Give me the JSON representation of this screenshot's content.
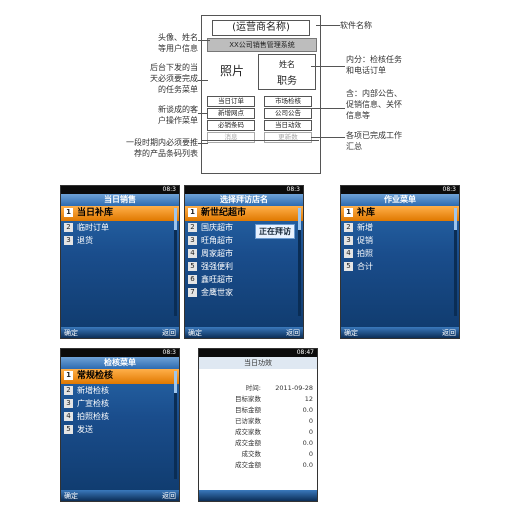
{
  "wireframe": {
    "title": "(运营商名称)",
    "subtitle": "XX公司销售管理系统",
    "photo": "照片",
    "name": "姓名",
    "position": "职务",
    "buttons": [
      "当日订单",
      "市场检核",
      "新增网点",
      "公司公告",
      "必销条码",
      "当日动效",
      "消息",
      "更新数"
    ],
    "annotations_left": [
      "头像、姓名\n等用户信息",
      "后台下发的当\n天必须要完成\n的任务菜单",
      "新谈成的客\n户操作菜单",
      "一段时期内必须要推\n荐的产品条码列表"
    ],
    "annotations_right": [
      "软件名称",
      "内分：检核任务\n和电话订单",
      "含：内部公告、\n促销信息、关怀\n信息等",
      "各项已完成工作\n汇总"
    ]
  },
  "screens": [
    {
      "status": "08:3",
      "title": "当日销售",
      "items": [
        {
          "num": "1",
          "label": "当日补库"
        },
        {
          "num": "2",
          "label": "临时订单"
        },
        {
          "num": "3",
          "label": "退货"
        }
      ],
      "left_soft": "确定",
      "right_soft": "返回"
    },
    {
      "status": "08:3",
      "title": "选择拜访店名",
      "items": [
        {
          "num": "1",
          "label": "新世纪超市"
        },
        {
          "num": "2",
          "label": "国庆超市"
        },
        {
          "num": "3",
          "label": "旺角超市"
        },
        {
          "num": "4",
          "label": "周家超市"
        },
        {
          "num": "5",
          "label": "强强便利"
        },
        {
          "num": "6",
          "label": "鑫旺超市"
        },
        {
          "num": "7",
          "label": "金鹰世家"
        }
      ],
      "popup": "正在拜访",
      "left_soft": "确定",
      "right_soft": "返回"
    },
    {
      "status": "08:3",
      "title": "作业菜单",
      "items": [
        {
          "num": "1",
          "label": "补库"
        },
        {
          "num": "2",
          "label": "新增"
        },
        {
          "num": "3",
          "label": "促销"
        },
        {
          "num": "4",
          "label": "拍照"
        },
        {
          "num": "5",
          "label": "合计"
        }
      ],
      "left_soft": "确定",
      "right_soft": "返回"
    },
    {
      "status": "08:3",
      "title": "检核菜单",
      "items": [
        {
          "num": "1",
          "label": "常规检核"
        },
        {
          "num": "2",
          "label": "新增检核"
        },
        {
          "num": "3",
          "label": "广宣检核"
        },
        {
          "num": "4",
          "label": "拍照检核"
        },
        {
          "num": "5",
          "label": "发送"
        }
      ],
      "left_soft": "确定",
      "right_soft": "返回"
    }
  ],
  "performance": {
    "status": "08:47",
    "title": "当日功效",
    "rows": [
      {
        "k": "时间:",
        "v": "2011-09-28"
      },
      {
        "k": "目标家数",
        "v": "12"
      },
      {
        "k": "目标金额",
        "v": "0.0"
      },
      {
        "k": "已访家数",
        "v": "0"
      },
      {
        "k": "成交家数",
        "v": "0"
      },
      {
        "k": "成交金额",
        "v": "0.0"
      },
      {
        "k": "成交数",
        "v": "0"
      },
      {
        "k": "成交金额",
        "v": "0.0"
      }
    ]
  }
}
